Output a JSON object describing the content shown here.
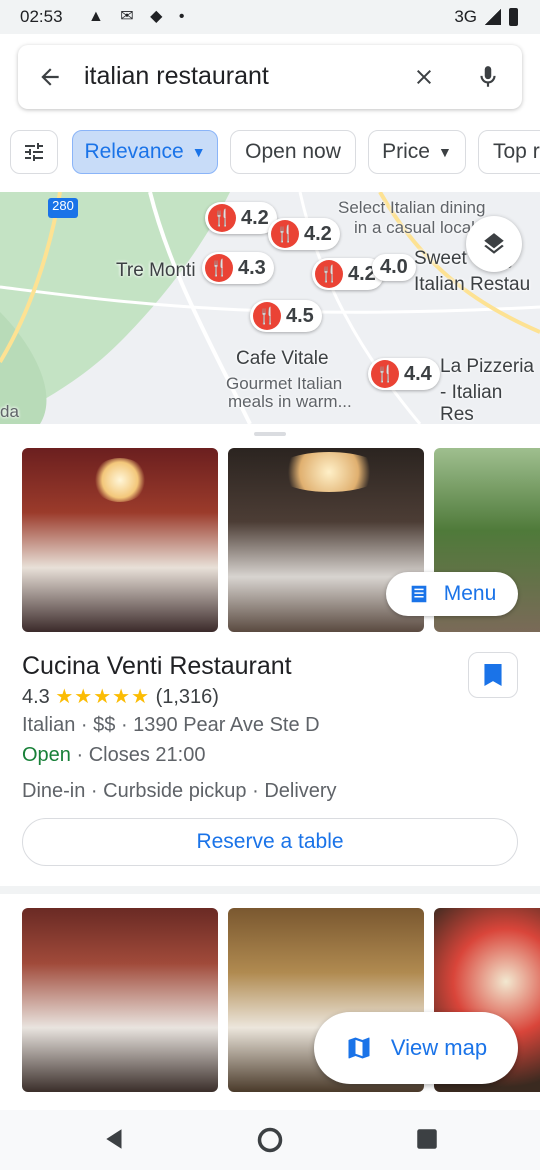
{
  "status": {
    "time": "02:53",
    "network": "3G"
  },
  "search": {
    "query": "italian restaurant"
  },
  "chips": [
    {
      "label": "Relevance",
      "has_dropdown": true,
      "selected": true
    },
    {
      "label": "Open now",
      "has_dropdown": false,
      "selected": false
    },
    {
      "label": "Price",
      "has_dropdown": true,
      "selected": false
    },
    {
      "label": "Top r",
      "has_dropdown": false,
      "selected": false
    }
  ],
  "map": {
    "highway": "280",
    "pins": [
      "4.2",
      "4.2",
      "4.3",
      "4.2",
      "4.0",
      "4.5",
      "4.4"
    ],
    "labels": {
      "select": "Select Italian dining",
      "select2": "in a casual locale",
      "tremonti": "Tre Monti",
      "sweet": "Sweet Sicily",
      "italianrest": "Italian Restau",
      "cafevitale": "Cafe Vitale",
      "gourmet": "Gourmet Italian",
      "meals": "meals in warm...",
      "lapizzeria": "La Pizzeria",
      "italianres": "- Italian Res",
      "da": "da"
    }
  },
  "listing": {
    "menu_label": "Menu",
    "name": "Cucina Venti Restaurant",
    "rating": "4.3",
    "stars": "★★★★★",
    "reviews": "(1,316)",
    "details": "Italian · $$ · 1390 Pear Ave Ste D",
    "open": "Open",
    "closes": " · Closes 21:00",
    "services": "Dine-in · Curbside pickup · Delivery",
    "reserve_label": "Reserve a table"
  },
  "view_map_label": "View map",
  "colors": {
    "accent": "#1a73e8",
    "open": "#188038",
    "pin": "#ea4335",
    "star": "#fbbc04"
  }
}
